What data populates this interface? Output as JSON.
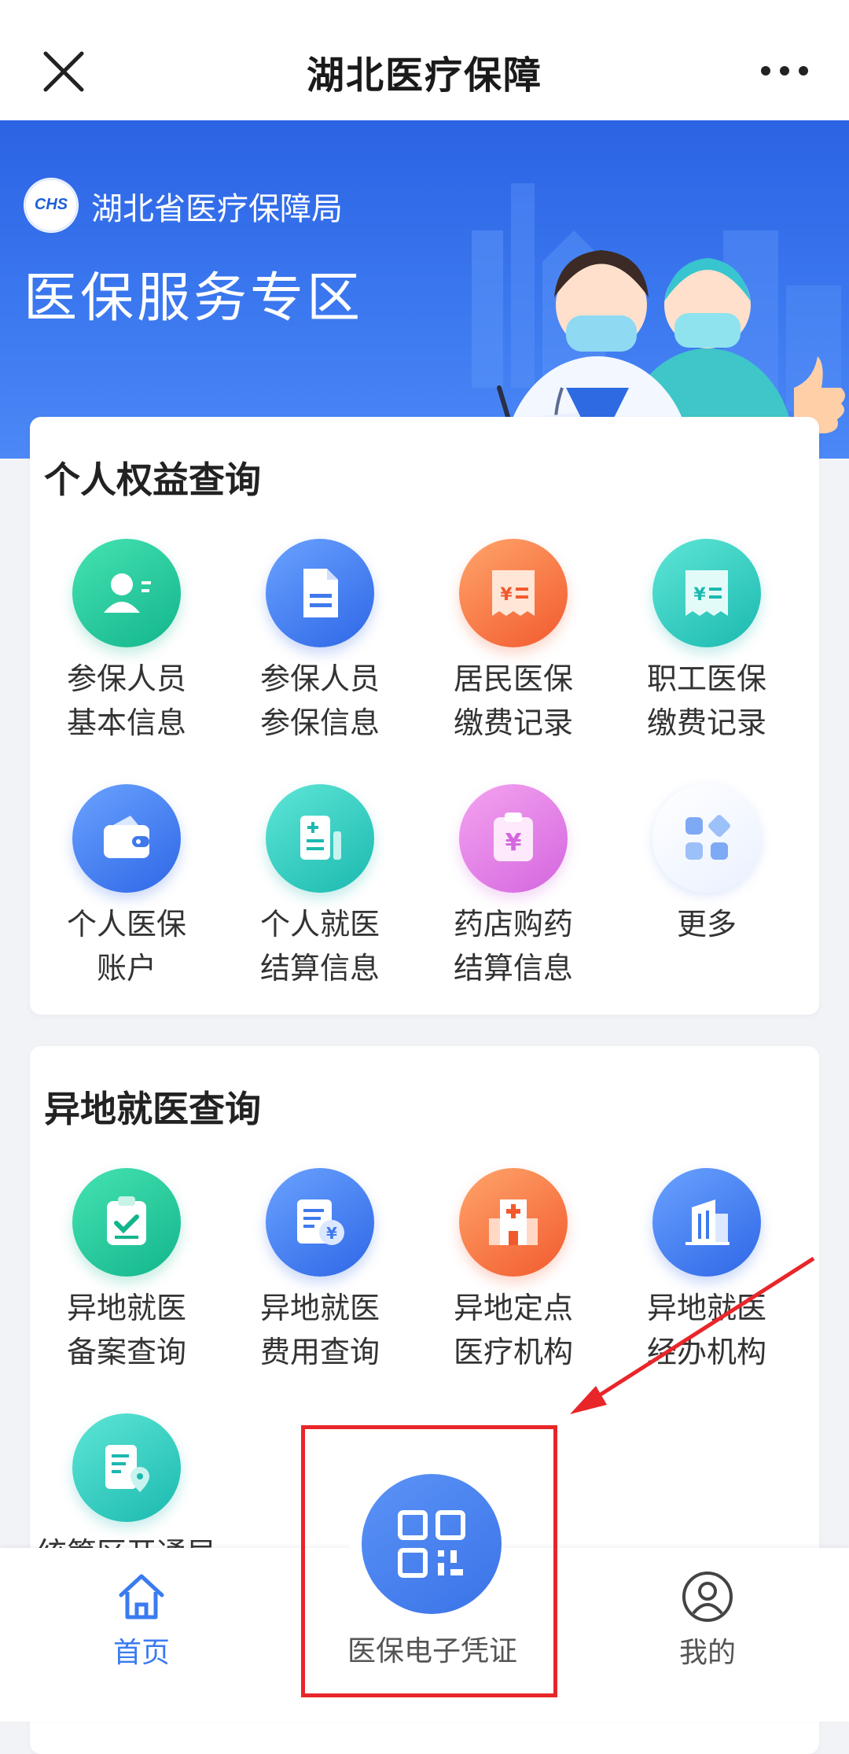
{
  "navbar": {
    "title": "湖北医疗保障",
    "close_icon": "close-icon",
    "more_icon": "more-dots-icon"
  },
  "banner": {
    "logo_text": "CHS",
    "org_name": "湖北省医疗保障局",
    "title": "医保服务专区"
  },
  "section_personal": {
    "title": "个人权益查询",
    "items": [
      {
        "label": "参保人员\n基本信息",
        "icon": "person-card-icon",
        "color": "green"
      },
      {
        "label": "参保人员\n参保信息",
        "icon": "document-icon",
        "color": "blue"
      },
      {
        "label": "居民医保\n缴费记录",
        "icon": "yuan-receipt-icon",
        "color": "orange"
      },
      {
        "label": "职工医保\n缴费记录",
        "icon": "yuan-receipt-icon",
        "color": "teal"
      },
      {
        "label": "个人医保\n账户",
        "icon": "wallet-icon",
        "color": "blue"
      },
      {
        "label": "个人就医\n结算信息",
        "icon": "medical-bill-icon",
        "color": "teal"
      },
      {
        "label": "药店购药\n结算信息",
        "icon": "yuan-clipboard-icon",
        "color": "pink"
      },
      {
        "label": "更多",
        "icon": "grid-more-icon",
        "color": "white"
      }
    ]
  },
  "section_remote": {
    "title": "异地就医查询",
    "items": [
      {
        "label": "异地就医\n备案查询",
        "icon": "clipboard-check-icon",
        "color": "green"
      },
      {
        "label": "异地就医\n费用查询",
        "icon": "bill-yuan-icon",
        "color": "blue"
      },
      {
        "label": "异地定点\n医疗机构",
        "icon": "hospital-icon",
        "color": "orange"
      },
      {
        "label": "异地就医\n经办机构",
        "icon": "building-icon",
        "color": "blue"
      },
      {
        "label": "统筹区开通局",
        "icon": "location-document-icon",
        "color": "teal"
      }
    ]
  },
  "tabbar": {
    "home_label": "首页",
    "center_label": "医保电子凭证",
    "mine_label": "我的"
  },
  "colors": {
    "accent": "#3a7bf0",
    "annotation_red": "#e8262a"
  }
}
